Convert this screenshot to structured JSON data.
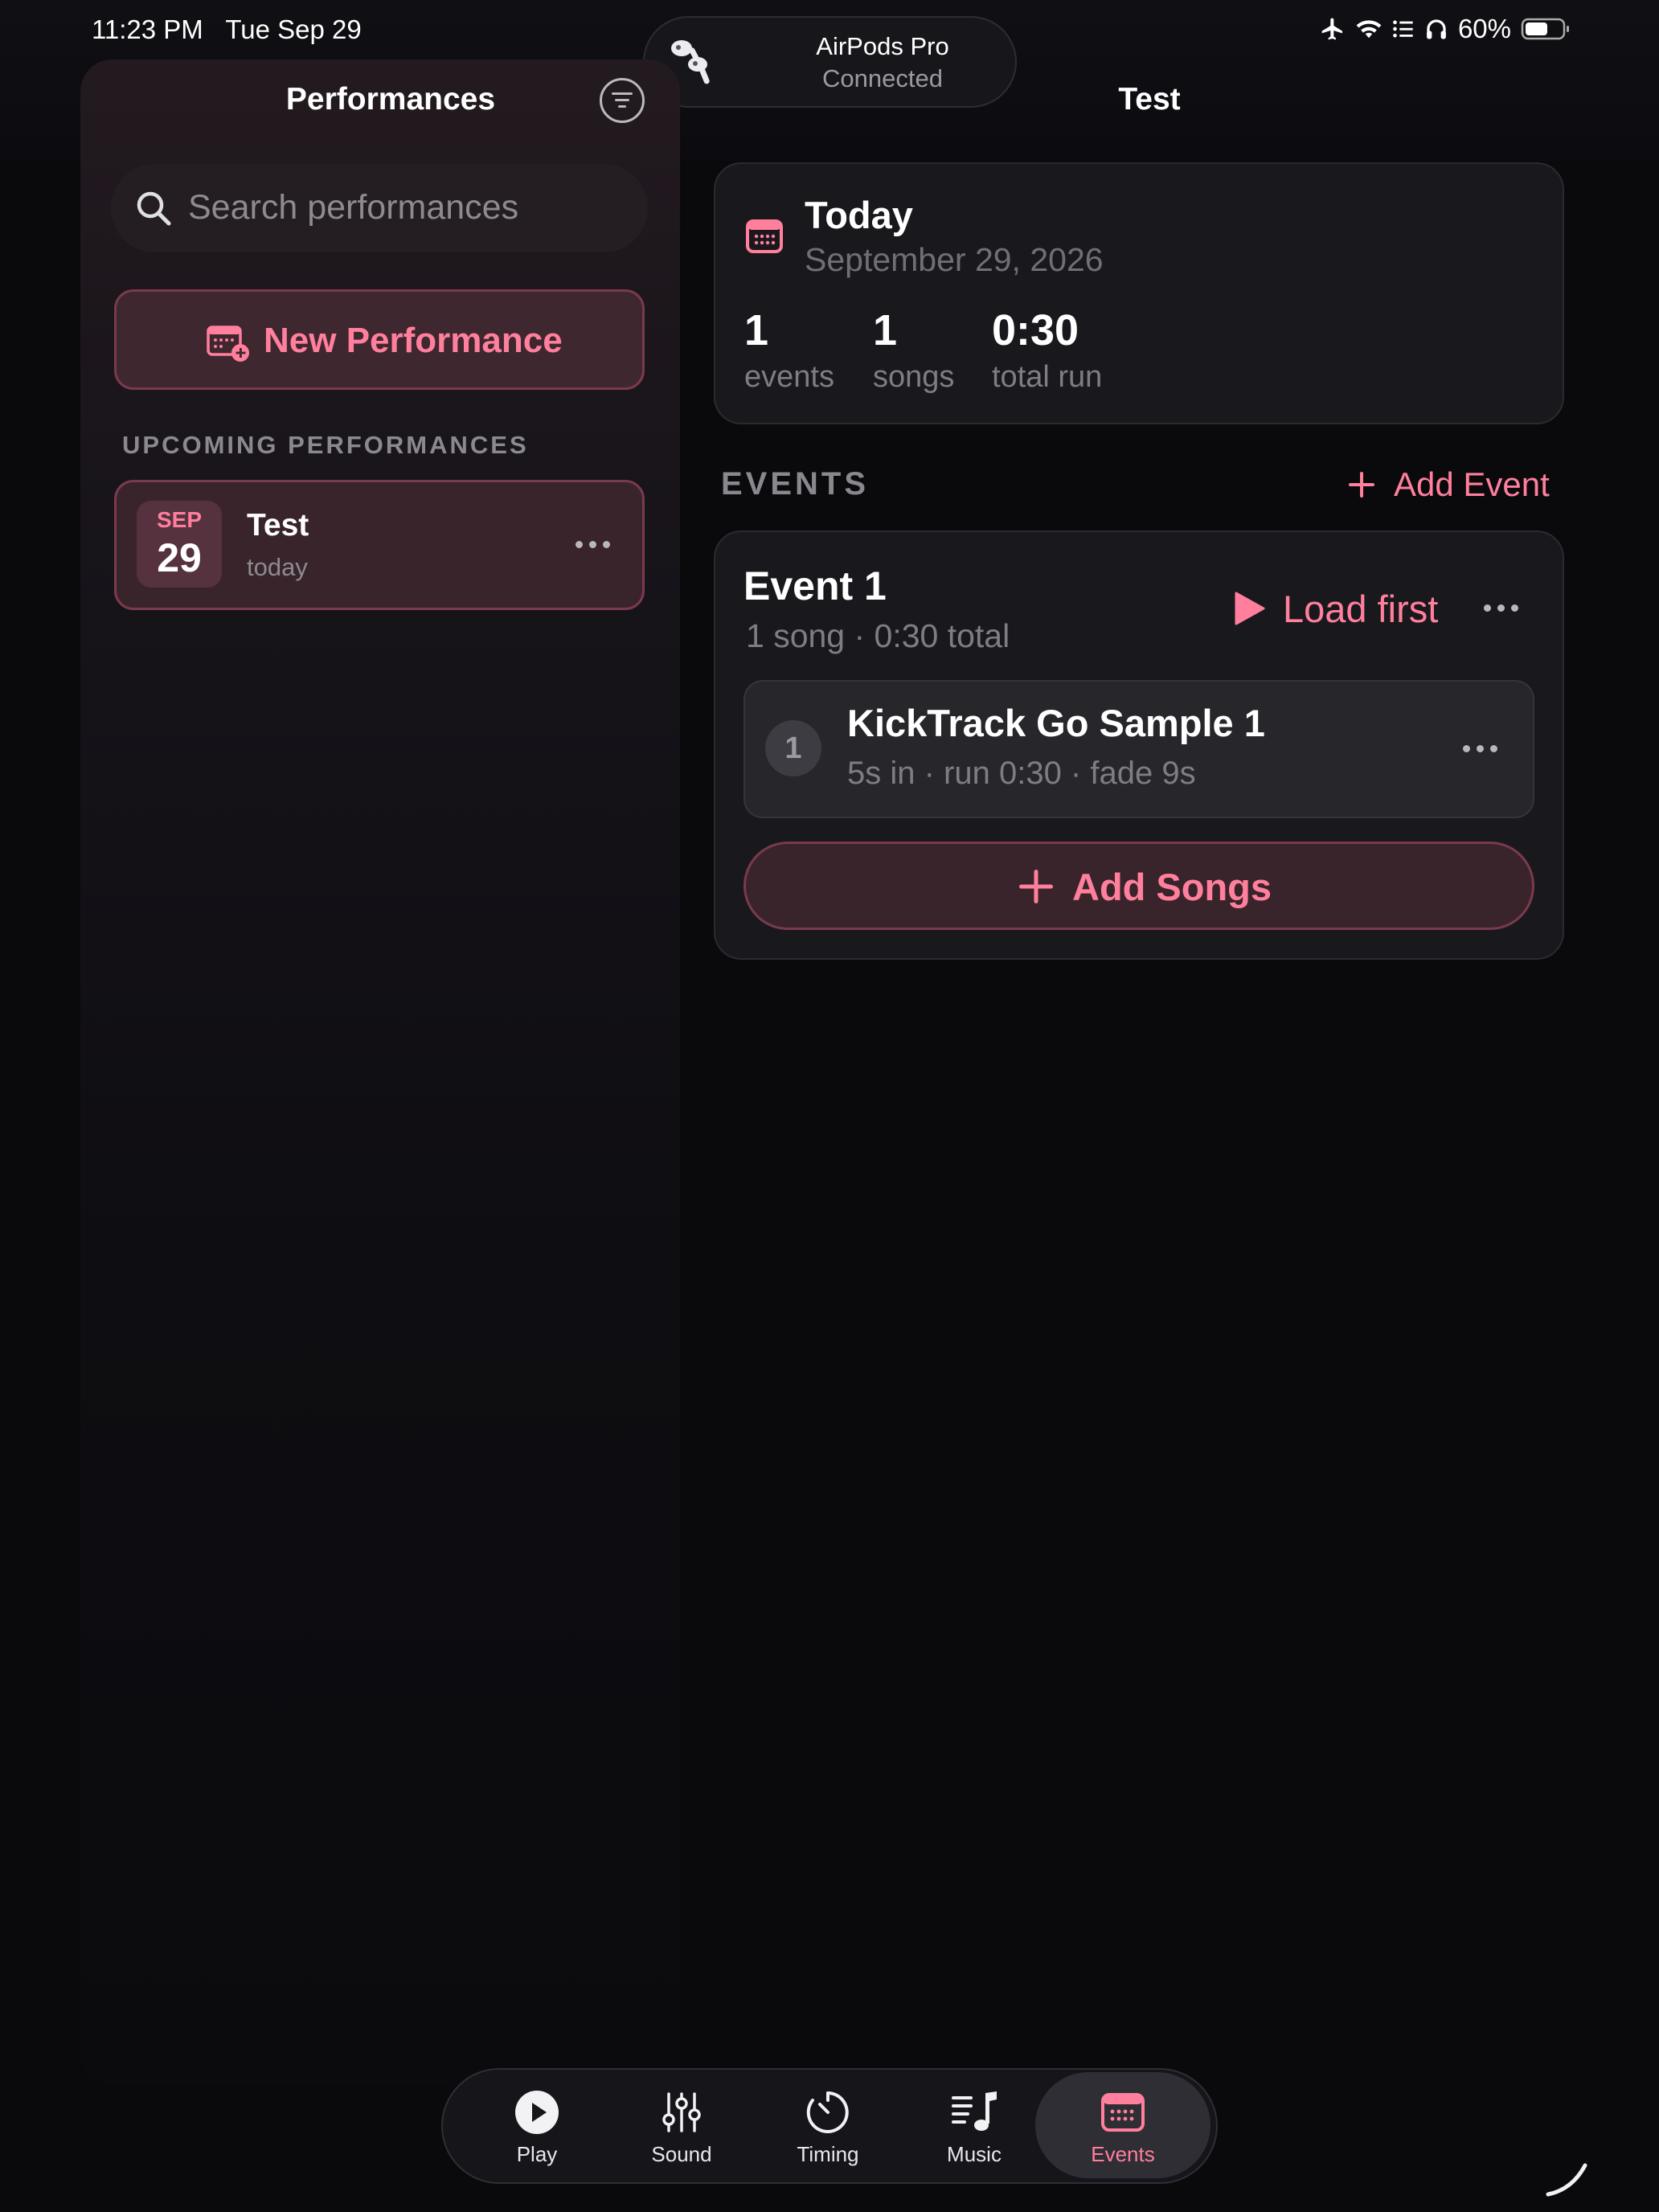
{
  "status_bar": {
    "time": "11:23 PM",
    "date": "Tue Sep 29",
    "battery": "60%",
    "icons": [
      "airplane-icon",
      "wifi-icon",
      "list-icon",
      "headphones-icon",
      "battery-icon"
    ]
  },
  "airpods_banner": {
    "title": "AirPods Pro",
    "status": "Connected"
  },
  "sidebar": {
    "title": "Performances",
    "search_placeholder": "Search performances",
    "new_button": "New Performance",
    "section_label": "UPCOMING PERFORMANCES",
    "performances": [
      {
        "month": "SEP",
        "day": "29",
        "name": "Test",
        "subtitle": "today"
      }
    ]
  },
  "main": {
    "title": "Test",
    "summary": {
      "heading": "Today",
      "date": "September 29, 2026",
      "stats": [
        {
          "value": "1",
          "label": "events"
        },
        {
          "value": "1",
          "label": "songs"
        },
        {
          "value": "0:30",
          "label": "total run"
        }
      ]
    },
    "events_label": "EVENTS",
    "add_event": "Add Event",
    "events": [
      {
        "title": "Event 1",
        "subtitle": "1 song · 0:30 total",
        "load_label": "Load first",
        "songs": [
          {
            "number": "1",
            "title": "KickTrack Go Sample 1",
            "details": "5s in · run 0:30 · fade 9s"
          }
        ],
        "add_songs": "Add Songs"
      }
    ]
  },
  "tab_bar": {
    "tabs": [
      {
        "label": "Play",
        "icon": "play-icon"
      },
      {
        "label": "Sound",
        "icon": "sliders-icon"
      },
      {
        "label": "Timing",
        "icon": "timer-icon"
      },
      {
        "label": "Music",
        "icon": "music-list-icon"
      },
      {
        "label": "Events",
        "icon": "calendar-icon",
        "active": true
      }
    ]
  },
  "colors": {
    "accent": "#ff7f9c",
    "background": "#0a0a0d",
    "card": "#19191d"
  }
}
